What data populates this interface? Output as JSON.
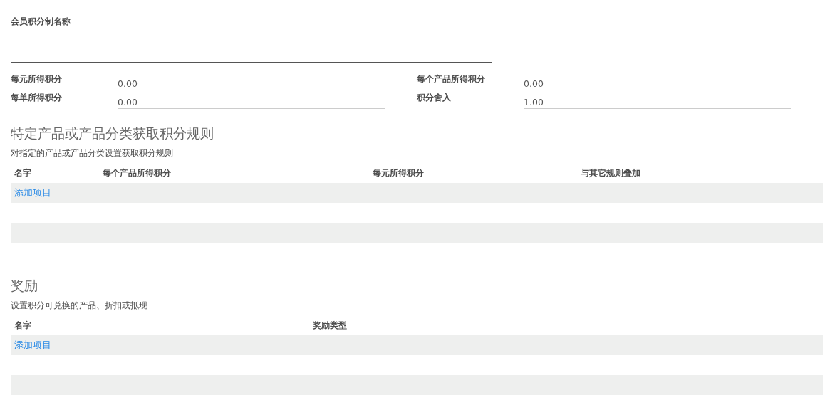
{
  "name_field": {
    "label": "会员积分制名称"
  },
  "fields": [
    {
      "label": "每元所得积分",
      "value": "0.00"
    },
    {
      "label": "每个产品所得积分",
      "value": "0.00"
    },
    {
      "label": "每单所得积分",
      "value": "0.00"
    },
    {
      "label": "积分舍入",
      "value": "1.00"
    }
  ],
  "sections": [
    {
      "title": "特定产品或产品分类获取积分规则",
      "subtitle": "对指定的产品或产品分类设置获取积分规则",
      "columns": [
        "名字",
        "每个产品所得积分",
        "每元所得积分",
        "与其它规则叠加"
      ],
      "add_link": "添加项目"
    },
    {
      "title": "奖励",
      "subtitle": "设置积分可兑换的产品、折扣或抵现",
      "columns": [
        "名字",
        "奖励类型"
      ],
      "add_link": "添加项目"
    }
  ]
}
